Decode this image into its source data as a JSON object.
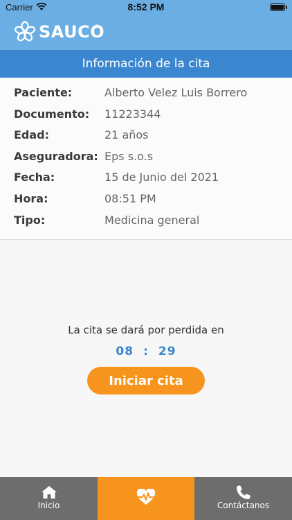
{
  "status_bar": {
    "carrier": "Carrier",
    "time": "8:52 PM"
  },
  "brand": {
    "name": "SAUCO",
    "registered": "®"
  },
  "header": {
    "title": "Información de la cita"
  },
  "appointment": {
    "rows": [
      {
        "label": "Paciente:",
        "value": "Alberto Velez Luis Borrero"
      },
      {
        "label": "Documento:",
        "value": "11223344"
      },
      {
        "label": "Edad:",
        "value": "21 años"
      },
      {
        "label": "Aseguradora:",
        "value": "Eps s.o.s"
      },
      {
        "label": "Fecha:",
        "value": "15 de Junio del 2021"
      },
      {
        "label": "Hora:",
        "value": "08:51 PM"
      },
      {
        "label": "Tipo:",
        "value": "Medicina general"
      }
    ]
  },
  "countdown": {
    "notice": "La cita se dará por perdida en",
    "minutes": "08",
    "separator": ":",
    "seconds": "29"
  },
  "actions": {
    "start_label": "Iniciar cita"
  },
  "bottom_nav": {
    "home_label": "Inicio",
    "contact_label": "Contáctanos"
  },
  "colors": {
    "header_light": "#6aaee3",
    "header_dark": "#3b87cf",
    "accent": "#f7941d",
    "nav_bg": "#6d6d6d"
  }
}
